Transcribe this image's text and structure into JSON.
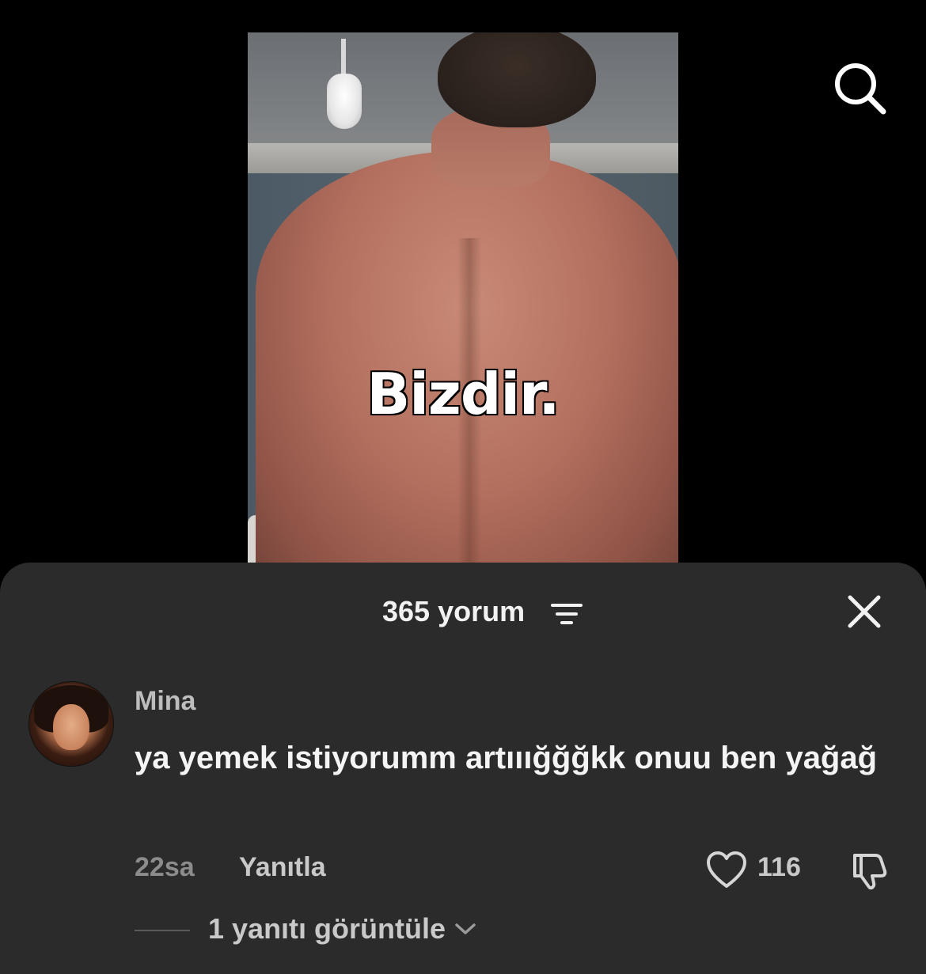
{
  "video": {
    "caption": "Bizdir."
  },
  "top_bar": {
    "search_icon": "search-icon"
  },
  "comments_sheet": {
    "count_label": "365 yorum",
    "filter_icon": "filter-icon",
    "close_icon": "close-icon",
    "comment": {
      "username": "Mina",
      "text": "ya yemek istiyorumm artııığğğkk onuu ben yağağ",
      "time": "22sa",
      "reply_label": "Yanıtla",
      "like_count": "116",
      "like_icon": "heart-outline-icon",
      "dislike_icon": "thumbs-down-icon",
      "view_replies_label": "1 yanıtı görüntüle",
      "view_replies_icon": "chevron-down-icon"
    }
  },
  "colors": {
    "sheet_background": "#2b2b2b",
    "primary_text": "#f4f4f4",
    "secondary_text": "#8c8c8c"
  }
}
